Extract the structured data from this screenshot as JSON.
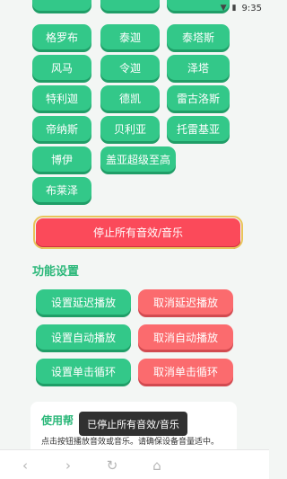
{
  "status_bar": {
    "time": "9:35"
  },
  "driver_buttons": [
    {
      "label": "格罗布"
    },
    {
      "label": "泰迦"
    },
    {
      "label": "泰塔斯"
    },
    {
      "label": "风马"
    },
    {
      "label": "令迦"
    },
    {
      "label": "泽塔"
    },
    {
      "label": "特利迦"
    },
    {
      "label": "德凯"
    },
    {
      "label": "雷古洛斯"
    },
    {
      "label": "帝纳斯"
    },
    {
      "label": "贝利亚"
    },
    {
      "label": "托雷基亚"
    },
    {
      "label": "博伊"
    },
    {
      "label": "盖亚超级至高"
    },
    {
      "label": "布莱泽"
    }
  ],
  "stop_all_label": "停止所有音效/音乐",
  "settings": {
    "title": "功能设置",
    "set_delay": "设置延迟播放",
    "cancel_delay": "取消延迟播放",
    "set_auto": "设置自动播放",
    "cancel_auto": "取消自动播放",
    "set_loop": "设置单击循环",
    "cancel_loop": "取消单击循环"
  },
  "usage": {
    "title": "使用帮",
    "line1": "点击按钮播放音效或音乐。请确保设备音量适中。"
  },
  "toast": "已停止所有音效/音乐",
  "colors": {
    "green": "#33c889",
    "red": "#fb6b6e",
    "stop": "#fb4a5a",
    "accent_text": "#2cb87a"
  }
}
